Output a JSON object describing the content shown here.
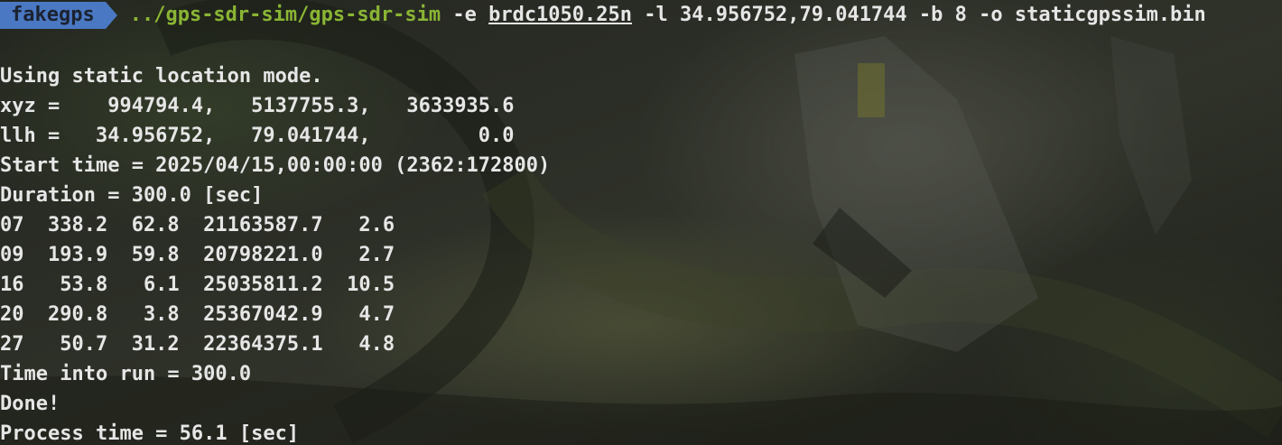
{
  "prompt": {
    "directory": "fakegps"
  },
  "command": {
    "executable": "../gps-sdr-sim/gps-sdr-sim",
    "flag_e": " -e ",
    "ephemeris_file": "brdc1050.25n",
    "rest": " -l 34.956752,79.041744 -b 8 -o staticgpssim.bin"
  },
  "output": [
    "Using static location mode.",
    "xyz =    994794.4,   5137755.3,   3633935.6",
    "llh =   34.956752,   79.041744,         0.0",
    "Start time = 2025/04/15,00:00:00 (2362:172800)",
    "Duration = 300.0 [sec]",
    "07  338.2  62.8  21163587.7   2.6",
    "09  193.9  59.8  20798221.0   2.7",
    "16   53.8   6.1  25035811.2  10.5",
    "20  290.8   3.8  25367042.9   4.7",
    "27   50.7  31.2  22364375.1   4.8",
    "Time into run = 300.0",
    "Done!",
    "Process time = 56.1 [sec]"
  ],
  "colors": {
    "prompt_bg": "#4a78c2",
    "path": "#8ab534",
    "text": "#e6e6e6"
  }
}
